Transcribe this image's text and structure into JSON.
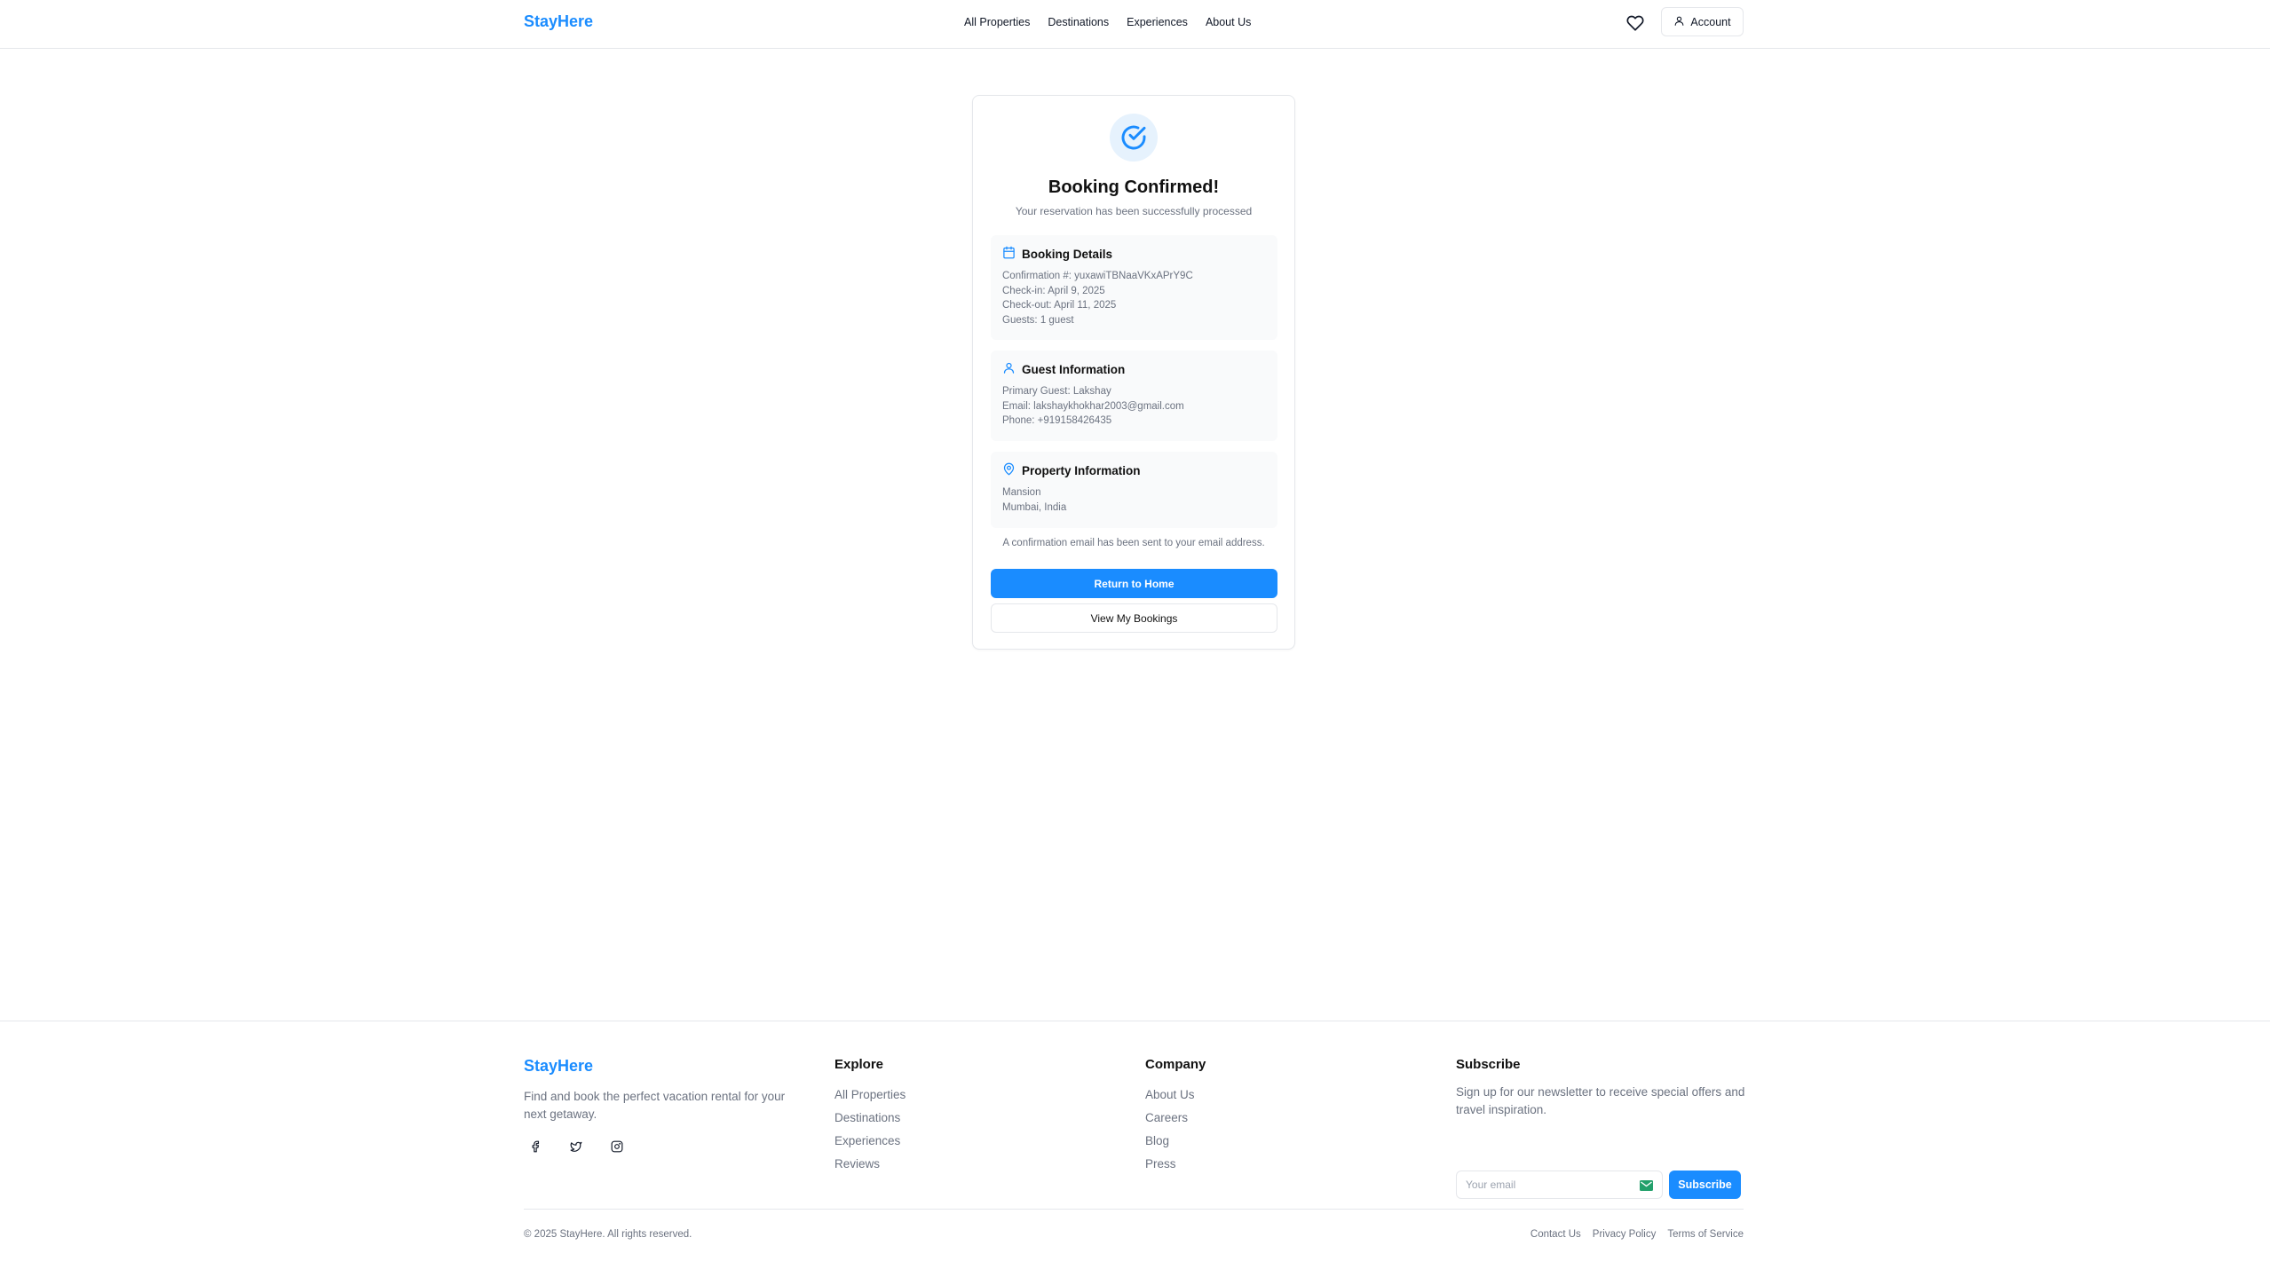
{
  "header": {
    "logo": "StayHere",
    "nav": [
      "All Properties",
      "Destinations",
      "Experiences",
      "About Us"
    ],
    "account_label": "Account"
  },
  "confirmation": {
    "title": "Booking Confirmed!",
    "subtitle": "Your reservation has been successfully processed",
    "booking": {
      "heading": "Booking Details",
      "confirmation": "Confirmation #: yuxawiTBNaaVKxAPrY9C",
      "checkin": "Check-in: April 9, 2025",
      "checkout": "Check-out: April 11, 2025",
      "guests": "Guests: 1 guest"
    },
    "guest": {
      "heading": "Guest Information",
      "primary": "Primary Guest: Lakshay",
      "email": "Email: lakshaykhokhar2003@gmail.com",
      "phone": "Phone: +919158426435"
    },
    "property": {
      "heading": "Property Information",
      "name": "Mansion",
      "location": "Mumbai, India"
    },
    "note": "A confirmation email has been sent to your email address.",
    "return_label": "Return to Home",
    "bookings_label": "View My Bookings"
  },
  "footer": {
    "logo": "StayHere",
    "description": "Find and book the perfect vacation rental for your next getaway.",
    "explore": {
      "heading": "Explore",
      "links": [
        "All Properties",
        "Destinations",
        "Experiences",
        "Reviews"
      ]
    },
    "company": {
      "heading": "Company",
      "links": [
        "About Us",
        "Careers",
        "Blog",
        "Press"
      ]
    },
    "subscribe": {
      "heading": "Subscribe",
      "description": "Sign up for our newsletter to receive special offers and travel inspiration.",
      "placeholder": "Your email",
      "button": "Subscribe"
    },
    "copyright": "© 2025 StayHere. All rights reserved.",
    "legal": [
      "Contact Us",
      "Privacy Policy",
      "Terms of Service"
    ]
  },
  "colors": {
    "accent": "#1a8cff",
    "muted_text": "#6b7280",
    "section_bg": "#f9fafb",
    "border": "#e5e7eb"
  }
}
